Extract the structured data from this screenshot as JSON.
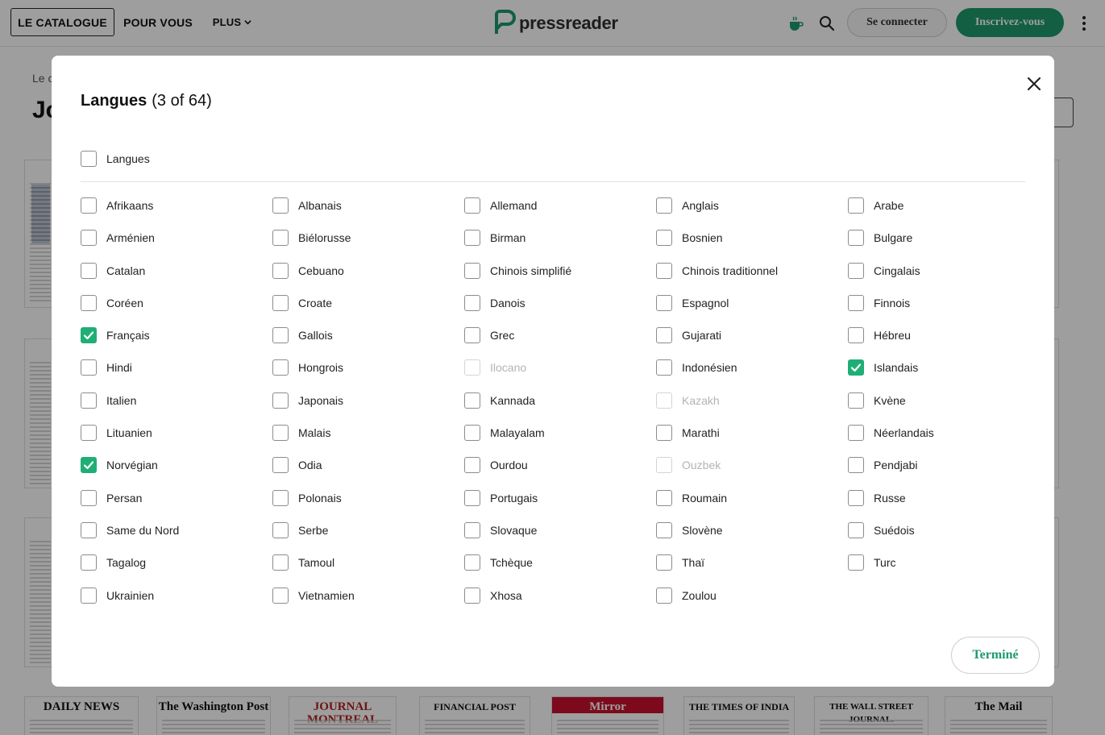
{
  "header": {
    "nav": [
      "LE CATALOGUE",
      "POUR VOUS",
      "PLUS"
    ],
    "logo_text": "pressreader",
    "signin_label": "Se connecter",
    "register_label": "Inscrivez-vous",
    "icons": [
      "coffee-cup-icon",
      "search-icon",
      "more-vert-icon"
    ],
    "accent_color": "#1d9a6c"
  },
  "background": {
    "breadcrumb": "Le c",
    "title": "Jo",
    "thumbnails": [
      {
        "masthead": "DAILY NEWS"
      },
      {
        "masthead": "The Washington Post"
      },
      {
        "masthead": "JOURNAL MONTREAL"
      },
      {
        "masthead": "FINANCIAL POST"
      },
      {
        "masthead": "Mirror"
      },
      {
        "masthead": "THE TIMES OF INDIA"
      },
      {
        "masthead": "THE WALL STREET JOURNAL."
      },
      {
        "masthead": "The Mail"
      }
    ]
  },
  "modal": {
    "title": "Langues",
    "count": "(3 of 64)",
    "all_label": "Langues",
    "all_checked": false,
    "done_label": "Terminé",
    "languages": [
      {
        "label": "Afrikaans",
        "checked": false,
        "disabled": false
      },
      {
        "label": "Albanais",
        "checked": false,
        "disabled": false
      },
      {
        "label": "Allemand",
        "checked": false,
        "disabled": false
      },
      {
        "label": "Anglais",
        "checked": false,
        "disabled": false
      },
      {
        "label": "Arabe",
        "checked": false,
        "disabled": false
      },
      {
        "label": "Arménien",
        "checked": false,
        "disabled": false
      },
      {
        "label": "Biélorusse",
        "checked": false,
        "disabled": false
      },
      {
        "label": "Birman",
        "checked": false,
        "disabled": false
      },
      {
        "label": "Bosnien",
        "checked": false,
        "disabled": false
      },
      {
        "label": "Bulgare",
        "checked": false,
        "disabled": false
      },
      {
        "label": "Catalan",
        "checked": false,
        "disabled": false
      },
      {
        "label": "Cebuano",
        "checked": false,
        "disabled": false
      },
      {
        "label": "Chinois simplifié",
        "checked": false,
        "disabled": false
      },
      {
        "label": "Chinois traditionnel",
        "checked": false,
        "disabled": false
      },
      {
        "label": "Cingalais",
        "checked": false,
        "disabled": false
      },
      {
        "label": "Coréen",
        "checked": false,
        "disabled": false
      },
      {
        "label": "Croate",
        "checked": false,
        "disabled": false
      },
      {
        "label": "Danois",
        "checked": false,
        "disabled": false
      },
      {
        "label": "Espagnol",
        "checked": false,
        "disabled": false
      },
      {
        "label": "Finnois",
        "checked": false,
        "disabled": false
      },
      {
        "label": "Français",
        "checked": true,
        "disabled": false
      },
      {
        "label": "Gallois",
        "checked": false,
        "disabled": false
      },
      {
        "label": "Grec",
        "checked": false,
        "disabled": false
      },
      {
        "label": "Gujarati",
        "checked": false,
        "disabled": false
      },
      {
        "label": "Hébreu",
        "checked": false,
        "disabled": false
      },
      {
        "label": "Hindi",
        "checked": false,
        "disabled": false
      },
      {
        "label": "Hongrois",
        "checked": false,
        "disabled": false
      },
      {
        "label": "Ilocano",
        "checked": false,
        "disabled": true
      },
      {
        "label": "Indonésien",
        "checked": false,
        "disabled": false
      },
      {
        "label": "Islandais",
        "checked": true,
        "disabled": false
      },
      {
        "label": "Italien",
        "checked": false,
        "disabled": false
      },
      {
        "label": "Japonais",
        "checked": false,
        "disabled": false
      },
      {
        "label": "Kannada",
        "checked": false,
        "disabled": false
      },
      {
        "label": "Kazakh",
        "checked": false,
        "disabled": true
      },
      {
        "label": "Kvène",
        "checked": false,
        "disabled": false
      },
      {
        "label": "Lituanien",
        "checked": false,
        "disabled": false
      },
      {
        "label": "Malais",
        "checked": false,
        "disabled": false
      },
      {
        "label": "Malayalam",
        "checked": false,
        "disabled": false
      },
      {
        "label": "Marathi",
        "checked": false,
        "disabled": false
      },
      {
        "label": "Néerlandais",
        "checked": false,
        "disabled": false
      },
      {
        "label": "Norvégian",
        "checked": true,
        "disabled": false
      },
      {
        "label": "Odia",
        "checked": false,
        "disabled": false
      },
      {
        "label": "Ourdou",
        "checked": false,
        "disabled": false
      },
      {
        "label": "Ouzbek",
        "checked": false,
        "disabled": true
      },
      {
        "label": "Pendjabi",
        "checked": false,
        "disabled": false
      },
      {
        "label": "Persan",
        "checked": false,
        "disabled": false
      },
      {
        "label": "Polonais",
        "checked": false,
        "disabled": false
      },
      {
        "label": "Portugais",
        "checked": false,
        "disabled": false
      },
      {
        "label": "Roumain",
        "checked": false,
        "disabled": false
      },
      {
        "label": "Russe",
        "checked": false,
        "disabled": false
      },
      {
        "label": "Same du Nord",
        "checked": false,
        "disabled": false
      },
      {
        "label": "Serbe",
        "checked": false,
        "disabled": false
      },
      {
        "label": "Slovaque",
        "checked": false,
        "disabled": false
      },
      {
        "label": "Slovène",
        "checked": false,
        "disabled": false
      },
      {
        "label": "Suédois",
        "checked": false,
        "disabled": false
      },
      {
        "label": "Tagalog",
        "checked": false,
        "disabled": false
      },
      {
        "label": "Tamoul",
        "checked": false,
        "disabled": false
      },
      {
        "label": "Tchèque",
        "checked": false,
        "disabled": false
      },
      {
        "label": "Thaï",
        "checked": false,
        "disabled": false
      },
      {
        "label": "Turc",
        "checked": false,
        "disabled": false
      },
      {
        "label": "Ukrainien",
        "checked": false,
        "disabled": false
      },
      {
        "label": "Vietnamien",
        "checked": false,
        "disabled": false
      },
      {
        "label": "Xhosa",
        "checked": false,
        "disabled": false
      },
      {
        "label": "Zoulou",
        "checked": false,
        "disabled": false
      }
    ]
  }
}
